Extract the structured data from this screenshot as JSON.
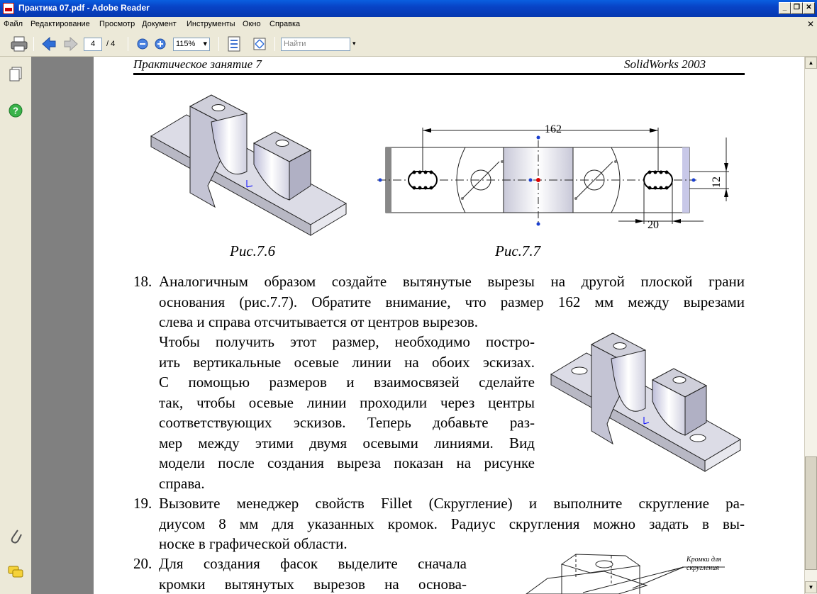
{
  "window": {
    "title": "Практика 07.pdf - Adobe Reader"
  },
  "menu": [
    "Файл",
    "Редактирование",
    "Просмотр",
    "Документ",
    "Инструменты",
    "Окно",
    "Справка"
  ],
  "toolbar": {
    "page_current": "4",
    "page_total": "/ 4",
    "zoom": "115%",
    "search_placeholder": "Найти"
  },
  "document": {
    "header_left": "Практическое занятие 7",
    "header_right": "SolidWorks 2003",
    "fig76_caption": "Рис.7.6",
    "fig77_caption": "Рис.7.7",
    "dim_162": "162",
    "dim_12": "12",
    "dim_20": "20",
    "item18_num": "18.",
    "item18_lines": [
      "Аналогичным образом создайте вытянутые вырезы на другой плоской грани",
      "основания (рис.7.7). Обратите внимание, что размер 162 мм между вырезами",
      "слева и справа отсчитывается от центров вырезов.",
      "Чтобы получить этот размер, необходимо постро-",
      "ить вертикальные осевые линии на обоих эскизах.",
      "С помощью размеров и взаимосвязей сделайте",
      "так, чтобы осевые линии проходили через центры",
      "соответствующих эскизов. Теперь добавьте раз-",
      "мер между этими двумя осевыми линиями. Вид",
      "модели после создания выреза показан на рисунке",
      "справа."
    ],
    "item19_num": "19.",
    "item19_lines": [
      "Вызовите менеджер свойств Fillet (Скругление) и выполните скругление ра-",
      "диусом 8 мм для указанных кромок. Радиус скругления можно задать в вы-",
      "носке в графической области."
    ],
    "item20_num": "20.",
    "item20_lines": [
      "Для создания фасок выделите сначала",
      "кромки вытянутых вырезов на основа-"
    ],
    "callout_line1": "Кромки для",
    "callout_line2": "скругления"
  }
}
